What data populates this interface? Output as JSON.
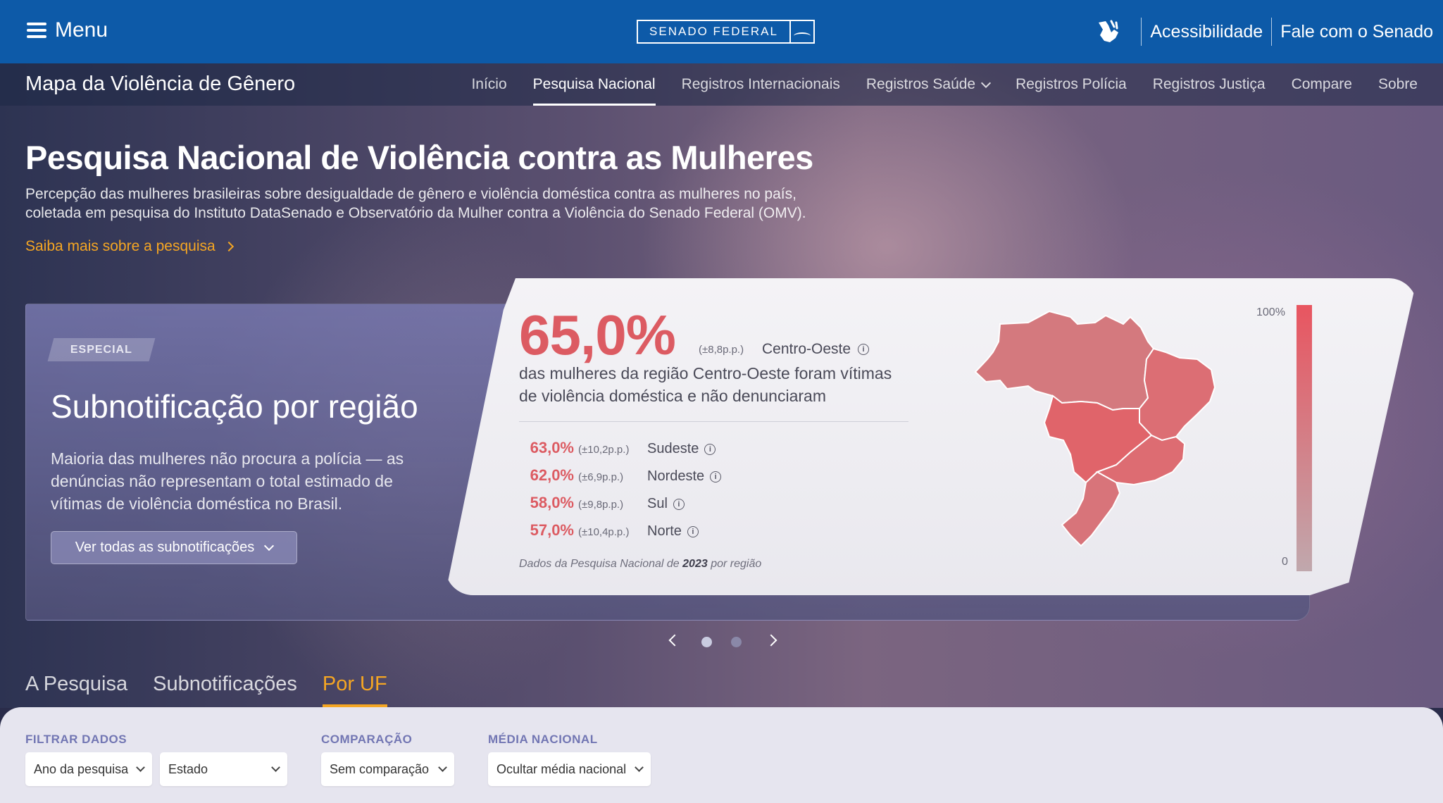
{
  "topbar": {
    "menu_label": "Menu",
    "logo_text": "SENADO FEDERAL",
    "accessibility": "Acessibilidade",
    "contact": "Fale com o Senado"
  },
  "nav": {
    "site_title": "Mapa da Violência de Gênero",
    "items": [
      {
        "label": "Início"
      },
      {
        "label": "Pesquisa Nacional",
        "active": true
      },
      {
        "label": "Registros Internacionais"
      },
      {
        "label": "Registros Saúde",
        "dropdown": true
      },
      {
        "label": "Registros Polícia"
      },
      {
        "label": "Registros Justiça"
      },
      {
        "label": "Compare"
      },
      {
        "label": "Sobre"
      }
    ]
  },
  "hero": {
    "title": "Pesquisa Nacional de Violência contra as Mulheres",
    "description": "Percepção das mulheres brasileiras sobre desigualdade de gênero e violência doméstica contra as mulheres no país, coletada em pesquisa do Instituto DataSenado e Observatório da Mulher contra a Violência do Senado Federal (OMV).",
    "more_link": "Saiba mais sobre a pesquisa"
  },
  "special": {
    "badge": "ESPECIAL",
    "title": "Subnotificação por região",
    "description": "Maioria das mulheres não procura a polícia — as denúncias não representam o total estimado de vítimas de violência doméstica no Brasil.",
    "button": "Ver todas as subnotificações"
  },
  "stat": {
    "main_value": "65,0%",
    "main_margin": "(±8,8p.p.)",
    "main_region": "Centro-Oeste",
    "main_desc": "das mulheres da região Centro-Oeste foram vítimas de violência doméstica e não denunciaram",
    "rows": [
      {
        "value": "63,0%",
        "margin": "(±10,2p.p.)",
        "region": "Sudeste"
      },
      {
        "value": "62,0%",
        "margin": "(±6,9p.p.)",
        "region": "Nordeste"
      },
      {
        "value": "58,0%",
        "margin": "(±9,8p.p.)",
        "region": "Sul"
      },
      {
        "value": "57,0%",
        "margin": "(±10,4p.p.)",
        "region": "Norte"
      }
    ],
    "source_prefix": "Dados da Pesquisa Nacional de ",
    "source_year": "2023",
    "source_suffix": " por região",
    "scale_max": "100%",
    "scale_min": "0",
    "colors": {
      "accent": "#dc5b62",
      "north": "#d4797e",
      "northeast": "#dc6e74",
      "centerwest": "#e0646a",
      "southeast": "#dd6c72",
      "south": "#d8747a"
    }
  },
  "tabs": [
    {
      "label": "A Pesquisa"
    },
    {
      "label": "Subnotificações"
    },
    {
      "label": "Por UF",
      "active": true
    }
  ],
  "filters": {
    "filter_label": "FILTRAR DADOS",
    "compare_label": "COMPARAÇÃO",
    "average_label": "MÉDIA NACIONAL",
    "year_select": "Ano da pesquisa",
    "state_select": "Estado",
    "compare_select": "Sem comparação",
    "average_select": "Ocultar média nacional"
  }
}
